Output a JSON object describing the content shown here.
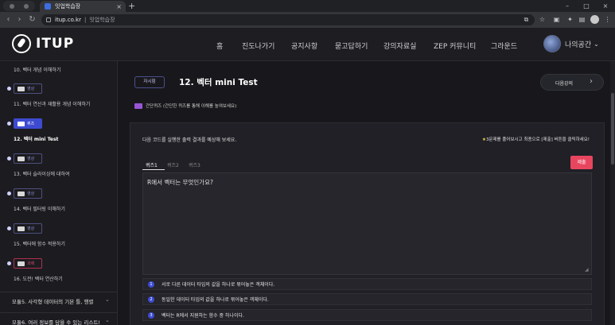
{
  "browser": {
    "tab_title": "잇업학습장",
    "tab_close": "×",
    "new_tab": "+",
    "url": "itup.co.kr",
    "page_title": "잇업학습장",
    "window_controls": [
      "–",
      "□",
      "×"
    ]
  },
  "site": {
    "logo_text": "ITUP",
    "nav": [
      "홈",
      "진도나가기",
      "공지사항",
      "묻고답하기",
      "강의자료실",
      "ZEP 커뮤니티",
      "그라운드"
    ],
    "user_name": "나의공간",
    "user_chevron": "⌄"
  },
  "sidebar": {
    "items": [
      {
        "label": "10. 벡터 개념 이해하기",
        "badge": null
      },
      {
        "label": "11. 벡터 연산과 재활용 개념 이해하기",
        "badge": "영상"
      },
      {
        "label": "12. 벡터 mini Test",
        "badge": "퀴즈",
        "current": true
      },
      {
        "label": "13. 벡터 슬라이싱에 대하여",
        "badge": "영상"
      },
      {
        "label": "14. 벡터 필터링 이해하기",
        "badge": "영상"
      },
      {
        "label": "15. 벡터에 함수 적용하기",
        "badge": "영상"
      },
      {
        "label": "16. 도전! 벡터 연산하기",
        "badge": "과제"
      }
    ],
    "modules": [
      {
        "label": "모듈5. 사각형 데이터의 기본 틀, 행렬",
        "chevron": "⌄"
      },
      {
        "label": "모듈6. 여러 정보를 담을 수 있는 리스트!",
        "chevron": "⌄"
      }
    ]
  },
  "main": {
    "type_label": "자시험",
    "title": "12. 벡터 mini Test",
    "next_label": "다음강의",
    "next_arrow": "›",
    "quiz_hint": "간단퀴즈 (간단한 퀴즈를 통해 이해를 높여보세요)",
    "instruction": "다음 코드를 실행한 출력 결과를 예상해 보세요.",
    "submit_hint_star": "★",
    "submit_hint": "3문제를 풀어보시고 최종으로 [제출] 버튼을 클릭하세요!",
    "tabs": [
      "퀴즈1",
      "퀴즈2",
      "퀴즈3"
    ],
    "submit_label": "제출",
    "question": "R에서 벡터는 무엇인가요?",
    "grip": "◢",
    "options": [
      {
        "num": "1",
        "text": "서로 다른 데이터 타입의 값을 하나로 묶어놓은 객체이다."
      },
      {
        "num": "2",
        "text": "동일한 데이터 타입의 값을 하나로 묶어놓은 객체이다."
      },
      {
        "num": "3",
        "text": "벡터는 R에서 지원하는 함수 중 하나이다."
      }
    ]
  }
}
